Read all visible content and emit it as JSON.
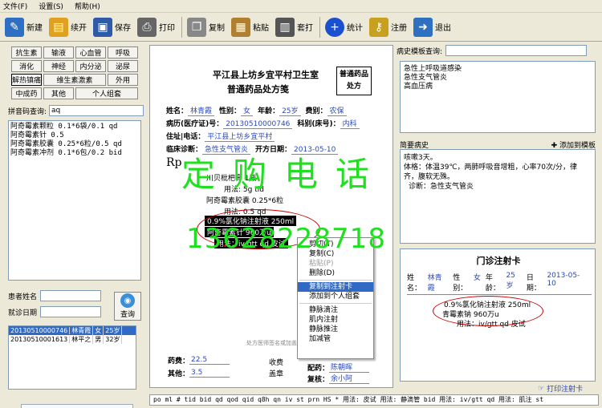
{
  "menu": [
    "文件(F)",
    "设置(S)",
    "帮助(H)"
  ],
  "toolbar": [
    {
      "label": "新建",
      "icon": "new-icon",
      "color": "#2e6fc4"
    },
    {
      "label": "续开",
      "icon": "folder-icon",
      "color": "#e0a020"
    },
    {
      "label": "保存",
      "icon": "save-icon",
      "color": "#2e5aa8"
    },
    {
      "label": "打印",
      "icon": "printer-icon",
      "color": "#666666"
    },
    {
      "label": "复制",
      "icon": "copy-icon",
      "color": "#888888"
    },
    {
      "label": "粘贴",
      "icon": "paste-icon",
      "color": "#b08030"
    },
    {
      "label": "套打",
      "icon": "template-print-icon",
      "color": "#555555"
    },
    {
      "label": "统计",
      "icon": "plus-circle-icon",
      "color": "#1a4fd0"
    },
    {
      "label": "注册",
      "icon": "key-icon",
      "color": "#c8a020"
    },
    {
      "label": "退出",
      "icon": "exit-icon",
      "color": "#3070c0"
    }
  ],
  "categories": [
    "抗生素",
    "输液",
    "心血管",
    "呼吸",
    "消化",
    "神经",
    "内分泌",
    "泌尿",
    "解热镇痛",
    "维生素激素",
    "外用",
    "中成药",
    "其他",
    "个人组套"
  ],
  "pinyin": {
    "label": "拼音码查询:",
    "value": "aq"
  },
  "drugs": [
    "阿奇霉素颗粒 0.1*6袋/0.1  qd",
    "阿奇霉素针  0.5",
    "阿奇霉素胶囊 0.25*6粒/0.5  qd",
    "阿奇霉素冲剂 0.1*6包/0.2 bid"
  ],
  "patient": {
    "name_label": "患者姓名",
    "date_label": "就诊日期",
    "query_label": "查询"
  },
  "patients": [
    [
      "20130510000746",
      "林青霞",
      "女",
      "25岁"
    ],
    [
      "20130510001613",
      "林平之",
      "男",
      "32岁"
    ]
  ],
  "rx": {
    "title": "平江县上坊乡宜平村卫生室",
    "subtitle": "普通药品处方笺",
    "stamp": "普通药品处方",
    "name_label": "姓名：",
    "name": "林青霞",
    "sex_label": "性别：",
    "sex": "女",
    "age_label": "年龄：",
    "age": "25岁",
    "fee_label": "费别：",
    "fee": "农保",
    "record_label": "病历(医疗证)号：",
    "record": "20130510000746",
    "dept_label": "科别(床号)：",
    "dept": "内科",
    "addr_label": "住址|电话：",
    "addr": "平江县上坊乡宜平村",
    "diag_label": "临床诊断：",
    "diag": "急性支气管炎",
    "date_label": "开方日期：",
    "date": "2013-05-10",
    "rp": "Rp",
    "lines": [
      "川贝枇杷膏 1瓶",
      "用法: 5g tid",
      "阿奇霉素胶囊 0.25*6粒",
      "用法: 0.5  qd",
      "0.9%氯化钠注射液  250ml",
      "阿奇霉素针  960万u",
      "用法：iv/gtt qd 皮试"
    ],
    "drug_fee_label": "药费：",
    "drug_fee": "22.5",
    "other_label": "其他：",
    "other": "3.5",
    "charge_label": "收费",
    "sign_label": "盖章",
    "dispense_label": "配药：",
    "dispense": "陈朝晖",
    "check_label": "复核：",
    "check": "余小阿",
    "note": "处方医师签名或加盖专用签章"
  },
  "context_menu": [
    "剪切(T)",
    "复制(C)",
    "粘贴(P)",
    "删除(D)",
    "复制到注射卡",
    "添加到个人组套",
    "静脉滴注",
    "肌内注射",
    "静脉推注",
    "加减管"
  ],
  "right": {
    "tpl_label": "病史模板查询:",
    "templates": [
      "急性上呼吸道感染",
      "急性支气管炎",
      "高血压病"
    ],
    "hist_label": "简要病史",
    "add_tpl": "添加到模板",
    "history": [
      "咳嗽3天。",
      "体格：体温39℃，两肺呼吸音增粗，心率70次/分，律齐，腹软无殊。",
      "诊断：急性支气管炎"
    ]
  },
  "card": {
    "title": "门诊注射卡",
    "name_label": "姓名：",
    "name": "林青霞",
    "sex_label": "性别：",
    "sex": "女",
    "age_label": "年龄：",
    "age": "25岁",
    "date_label": "日期：",
    "date": "2013-05-10",
    "line1": "0.9%氯化钠注射液  250ml",
    "line2": "青霉素钠  960万u",
    "line3": "用法：iv/gtt qd 皮试",
    "print": "打印注射卡"
  },
  "bottom": "po ml # tid bid qd qod qid q8h qn iv st prn HS * 用法: 皮试 用法: 静滴管 bid 用法: iv/gtt qd 用法: 肌注 st",
  "watermark": {
    "line1": "定购电话",
    "line2": "13628228718"
  }
}
